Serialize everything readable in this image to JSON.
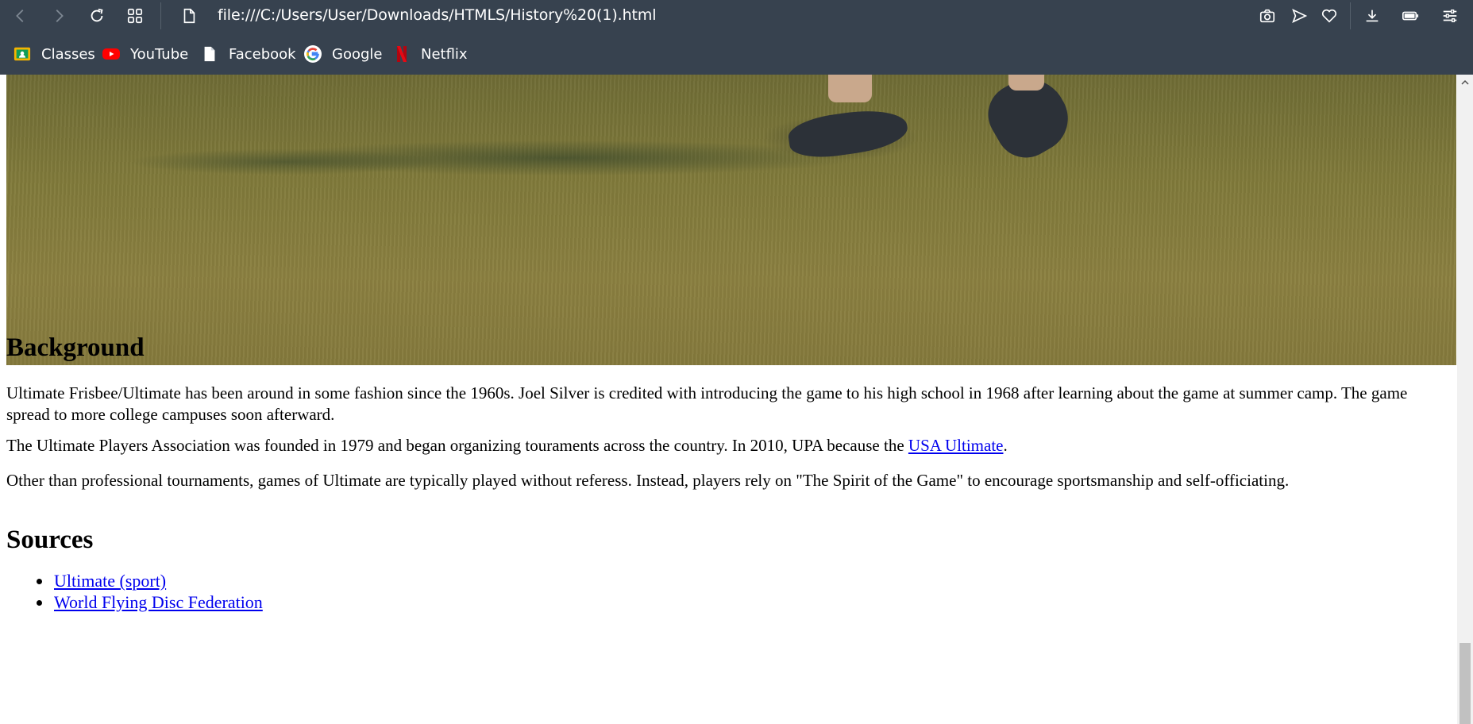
{
  "browser": {
    "url": "file:///C:/Users/User/Downloads/HTMLS/History%20(1).html",
    "bookmarks": [
      {
        "label": "Classes",
        "icon": "classroom-icon"
      },
      {
        "label": "YouTube",
        "icon": "youtube-icon"
      },
      {
        "label": "Facebook",
        "icon": "file-icon"
      },
      {
        "label": "Google",
        "icon": "google-icon"
      },
      {
        "label": "Netflix",
        "icon": "netflix-icon"
      }
    ],
    "colors": {
      "chrome": "#37424f",
      "link": "#0000ee"
    }
  },
  "page": {
    "background_heading": "Background",
    "paragraphs": {
      "p1": "Ultimate Frisbee/Ultimate has been around in some fashion since the 1960s. Joel Silver is credited with introducing the game to his high school in 1968 after learning about the game at summer camp. The game spread to more college campuses soon afterward.",
      "p2_before": "The Ultimate Players Association was founded in 1979 and began organizing touraments across the country. In 2010, UPA because the ",
      "p2_link": "USA Ultimate",
      "p2_after": ".",
      "p3": "Other than professional tournaments, games of Ultimate are typically played without referess. Instead, players rely on \"The Spirit of the Game\" to encourage sportsmanship and self-officiating."
    },
    "sources_heading": "Sources",
    "sources": [
      {
        "label": "Ultimate (sport)"
      },
      {
        "label": "World Flying Disc Federation"
      }
    ]
  }
}
